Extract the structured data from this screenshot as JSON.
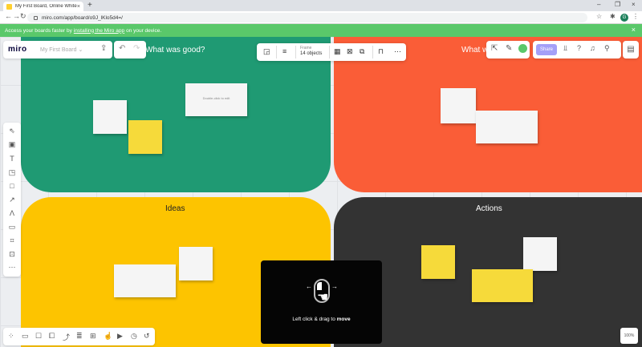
{
  "browser": {
    "tab_title": "My First Board, Online Whiteboar",
    "tab_close": "×",
    "new_tab": "+",
    "url": "miro.com/app/board/o9J_lKlo5d4=/",
    "win_min": "–",
    "win_max": "❐",
    "win_close": "×"
  },
  "banner": {
    "prefix": "Access your boards faster by",
    "link": "installing the Miro app",
    "suffix": "on your device.",
    "close": "×"
  },
  "topbar": {
    "logo": "miro",
    "board_name": "My First Board",
    "board_name_caret": "⌄"
  },
  "context_toolbar": {
    "frame_type": "Frame",
    "object_count": "14 objects"
  },
  "share_label": "Share",
  "frames": {
    "good": {
      "title": "What was good?"
    },
    "bad": {
      "title": "What w"
    },
    "ideas": {
      "title": "Ideas"
    },
    "actions": {
      "title": "Actions"
    }
  },
  "stickies": {
    "text_card": "Double-click to edit"
  },
  "zoom": "100%",
  "hint": {
    "text_prefix": "Left click & drag to",
    "text_bold": "move"
  },
  "colors": {
    "good": "#1f9a73",
    "bad": "#fa5d37",
    "ideas": "#fdc400",
    "actions": "#333333",
    "banner": "#5ac86a",
    "share": "#a4a0f8"
  }
}
